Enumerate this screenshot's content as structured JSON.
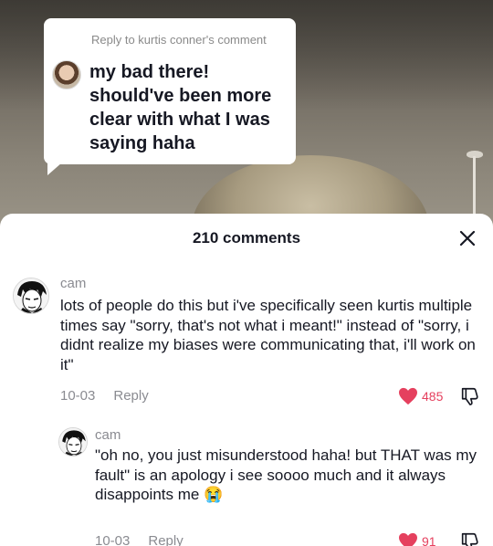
{
  "reply_card": {
    "header": "Reply to kurtis conner's comment",
    "text": "my bad there! should've been more clear with what I was saying haha"
  },
  "panel": {
    "title": "210 comments"
  },
  "comments": [
    {
      "username": "cam",
      "text": "lots of people do this but i've specifically seen kurtis multiple times say \"sorry, that's not what i meant!\" instead of \"sorry, i didnt realize my biases were communicating that, i'll work on it\"",
      "date": "10-03",
      "reply_label": "Reply",
      "likes": "485"
    },
    {
      "username": "cam",
      "text": "\"oh no, you just misunderstood haha! but THAT was my fault\" is an apology i see soooo much and it always disappoints me",
      "emoji": "😭",
      "date": "10-03",
      "reply_label": "Reply",
      "likes": "91"
    }
  ],
  "colors": {
    "like_red": "#e5405e",
    "meta_gray": "#8a8b91",
    "text_dark": "#161823"
  },
  "icons": [
    "close-icon",
    "heart-icon",
    "dislike-icon"
  ]
}
